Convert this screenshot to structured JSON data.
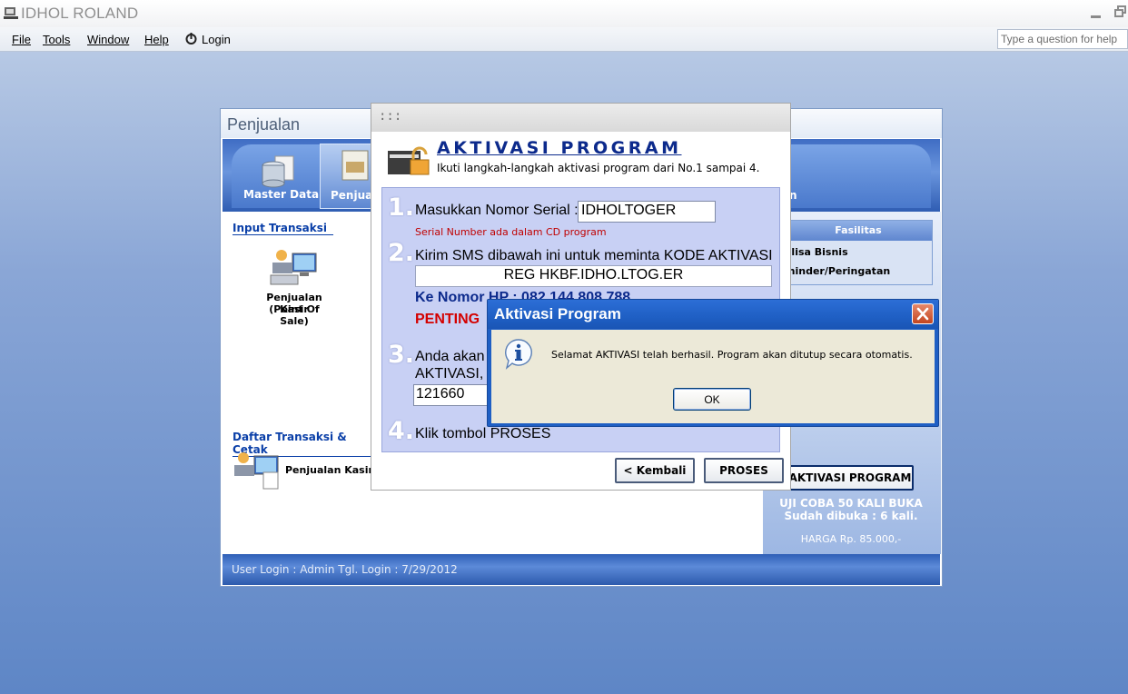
{
  "window": {
    "title": "IDHOL ROLAND"
  },
  "menu": {
    "items": [
      {
        "label": "File"
      },
      {
        "label": "Tools"
      },
      {
        "label": "Window"
      },
      {
        "label": "Help"
      },
      {
        "label": "Login"
      }
    ],
    "help_placeholder": "Type a question for help"
  },
  "penjualan": {
    "title": "Penjualan",
    "ribbon": {
      "master_data": "Master Data",
      "penjualan": "Penjua",
      "right_partial": "n"
    },
    "input_transaksi": "Input Transaksi",
    "kasir_line1": "Penjualan Kasir",
    "kasir_line2": "(Point Of Sale)",
    "daftar": "Daftar Transaksi & Cetak",
    "daftar_item": "Penjualan Kasir",
    "fasilitas": {
      "header": "Fasilitas",
      "items": [
        "alisa Bisnis",
        "minder/Peringatan"
      ]
    },
    "aktivasi_button": "AKTIVASI PROGRAM",
    "trial_line1": "UJI COBA 50 KALI BUKA",
    "trial_line2": "Sudah dibuka : 6 kali.",
    "harga": "HARGA Rp. 85.000,-",
    "status": "User Login : Admin  Tgl. Login : 7/29/2012"
  },
  "activation": {
    "title_dots": ":::",
    "heading": "AKTIVASI PROGRAM",
    "subtitle": "Ikuti langkah-langkah aktivasi program dari No.1 sampai 4.",
    "steps": [
      {
        "num": "1.",
        "text": "Masukkan Nomor Serial :"
      },
      {
        "num": "2.",
        "text": "Kirim SMS dibawah ini untuk meminta KODE AKTIVASI"
      },
      {
        "num": "3.",
        "text": "Anda akan"
      },
      {
        "num": "4.",
        "text": "Klik tombol PROSES"
      }
    ],
    "serial_value": "IDHOLTOGER",
    "serial_note": "Serial Number ada dalam CD program",
    "sms_value": "REG  HKBF.IDHO.LTOG.ER",
    "ke_nomor": "Ke Nomor HP : 082 144 808 788",
    "penting": "PENTING",
    "step3_line2": "AKTIVASI,",
    "code_value": "121660",
    "back_button": "< Kembali",
    "proses_button": "PROSES"
  },
  "message": {
    "title": "Aktivasi Program",
    "text": "Selamat AKTIVASI telah berhasil. Program akan ditutup secara otomatis.",
    "ok": "OK"
  },
  "colors": {
    "accent": "#0c2a8c",
    "warning": "#d40000",
    "xp_blue": "#1f5fc4"
  }
}
